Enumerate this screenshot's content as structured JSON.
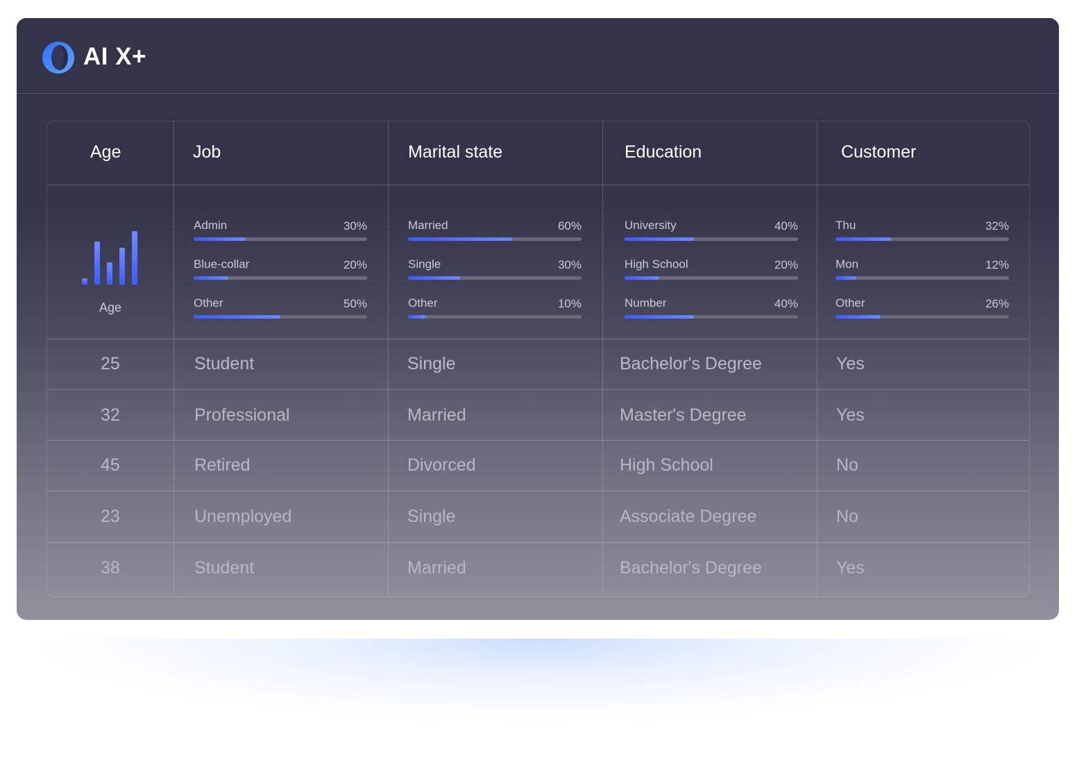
{
  "app": {
    "title": "AI X+"
  },
  "table": {
    "headers": [
      "Age",
      "Job",
      "Marital state",
      "Education",
      "Customer"
    ],
    "age_summary": {
      "label": "Age",
      "distribution": [
        0.12,
        0.81,
        0.41,
        0.69,
        1.0
      ]
    },
    "summaries": [
      {
        "column": "Job",
        "items": [
          {
            "label": "Admin",
            "value": "30%",
            "pct": 30
          },
          {
            "label": "Blue-collar",
            "value": "20%",
            "pct": 20
          },
          {
            "label": "Other",
            "value": "50%",
            "pct": 50
          }
        ]
      },
      {
        "column": "Marital state",
        "items": [
          {
            "label": "Married",
            "value": "60%",
            "pct": 60
          },
          {
            "label": "Single",
            "value": "30%",
            "pct": 30
          },
          {
            "label": "Other",
            "value": "10%",
            "pct": 10
          }
        ]
      },
      {
        "column": "Education",
        "items": [
          {
            "label": "University",
            "value": "40%",
            "pct": 40
          },
          {
            "label": "High School",
            "value": "20%",
            "pct": 20
          },
          {
            "label": "Number",
            "value": "40%",
            "pct": 40
          }
        ]
      },
      {
        "column": "Customer",
        "items": [
          {
            "label": "Thu",
            "value": "32%",
            "pct": 32
          },
          {
            "label": "Mon",
            "value": "12%",
            "pct": 12
          },
          {
            "label": "Other",
            "value": "26%",
            "pct": 26
          }
        ]
      }
    ],
    "rows": [
      [
        "25",
        "Student",
        "Single",
        "Bachelor's Degree",
        "Yes"
      ],
      [
        "32",
        "Professional",
        "Married",
        "Master's Degree",
        "Yes"
      ],
      [
        "45",
        "Retired",
        "Divorced",
        "High School",
        "No"
      ],
      [
        "23",
        "Unemployed",
        "Single",
        "Associate Degree",
        "No"
      ],
      [
        "38",
        "Student",
        "Married",
        "Bachelor's Degree",
        "Yes"
      ]
    ]
  },
  "colors": {
    "accent": "#3b5bff",
    "accent_light": "#6d88ff",
    "track": "#6a6a7a",
    "window_bg": "#33344a"
  }
}
